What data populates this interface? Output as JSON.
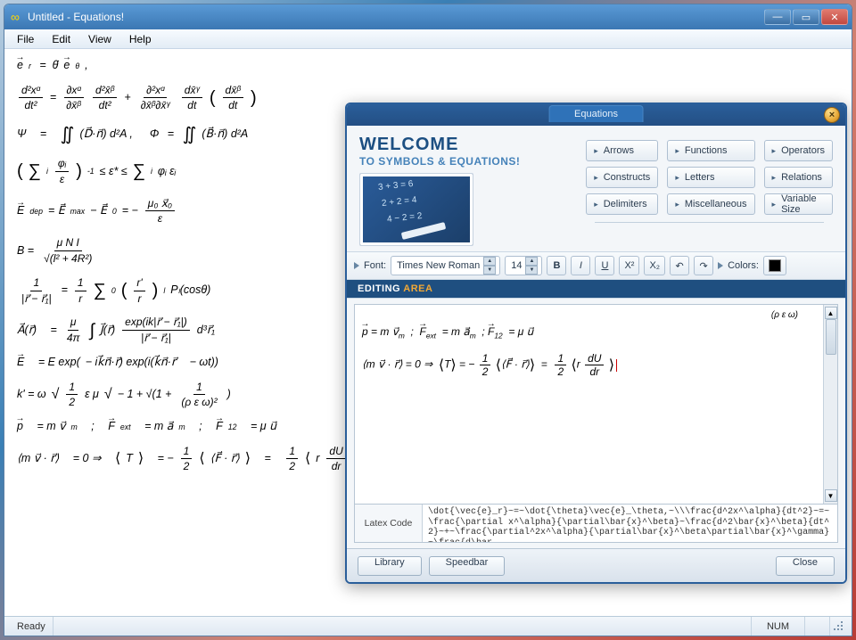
{
  "window": {
    "title": "Untitled - Equations!"
  },
  "menubar": {
    "items": [
      "File",
      "Edit",
      "View",
      "Help"
    ]
  },
  "statusbar": {
    "ready": "Ready",
    "num": "NUM"
  },
  "document": {
    "eq1": {
      "l": "e⃗",
      "lsub": "r",
      "r": "θ̇ e⃗",
      "rsub": "θ"
    },
    "eq2": {
      "f1_n": "d²xᵅ",
      "f1_d": "dt²",
      "eq": "=",
      "f2_n": "∂xᵅ",
      "f2_d": "∂x̄ᵝ",
      "f3_n": "d²x̄ᵝ",
      "f3_d": "dt²",
      "plus": "+",
      "f4_n": "∂²xᵅ",
      "f4_d": "∂x̄ᵝ∂x̄ᵞ",
      "f5_n": "dx̄ᵞ",
      "f5_d": "dt",
      "f6_n": "dx̄ᵝ",
      "f6_d": "dt"
    },
    "eq3": {
      "psi": "Ψ",
      "eq": "=",
      "int": "∬",
      "d1": "(D⃗·n⃗) d²A ,",
      "phi": "Φ",
      "b1": "(B⃗·n⃗) d²A"
    },
    "eq4": {
      "sum": "∑",
      "sub": "i",
      "f_n": "φᵢ",
      "f_d": "ε",
      "exp1": "-1",
      "le": "≤ ε* ≤",
      "sum2": "∑",
      "f2_n": "φᵢ εᵢ",
      "f2_d": ""
    },
    "eq5": {
      "E": "E⃗",
      "dep": "dep",
      "eq": "= E⃗",
      "max": "max",
      "minus": "− E⃗",
      "zero": "0",
      "eq2": "= −",
      "f_n": "μ₀ x⃗₀",
      "f_d": "ε"
    },
    "eq6": {
      "B": "B =",
      "f_n": "μ N I",
      "f_d": "√(l² + 4R²)"
    },
    "eq7": {
      "f1_n": "1",
      "f1_d": "|r⃗ − r⃗₁|",
      "eq": "=",
      "f2_n": "1",
      "f2_d": "r",
      "sum": "∑",
      "sub": "0",
      "sup": "l",
      "f3_n": "r'",
      "f3_d": "r",
      "exp": "l",
      "P": "Pₗ(cosθ)"
    },
    "eq8": {
      "A": "A⃗(r⃗)",
      "eq": "=",
      "f1_n": "μ",
      "f1_d": "4π",
      "int": "∫",
      "J": "J⃗(r⃗)",
      "f2_n": "exp(ik|r⃗ − r⃗₁|)",
      "f2_d": "|r⃗ − r⃗₁|",
      "d3r": "d³r⃗₁"
    },
    "eq9": {
      "E": "E⃗",
      "eq": "= E exp(",
      "minus": "− ik⃗n⃗·r⃗) exp(i(k⃗n⃗·r⃗",
      "om": "− ωt))"
    },
    "eq10": {
      "k": "k' = ω",
      "sqrt": "√",
      "f1_n": "1",
      "f1_d": "2",
      "eps": "ε μ",
      "sqrt2": "√",
      "expr": "− 1 + √(1 +",
      "f2_n": "1",
      "f2_d": "(ρ ε ω)²",
      "close": ")"
    },
    "eq11": {
      "p": "p⃗",
      "eq": "= m v⃗",
      "m": "m",
      "sep": ";",
      "F": "F⃗",
      "ext": "ext",
      "eq2": "= m a⃗",
      "sep2": ";",
      "F12": "F⃗",
      "sub12": "12",
      "eq3": "= μ u⃗"
    },
    "eq12": {
      "avg": "⟨m v⃗ · r⃗⟩",
      "eq": "= 0 ⇒",
      "T": "⟨T⟩",
      "eq2": "= −",
      "f1_n": "1",
      "f1_d": "2",
      "Fr": "⟨F⃗ · r⃗⟩",
      "eq3": "=",
      "f2_n": "1",
      "f2_d": "2",
      "br": "⟨r",
      "f3_n": "dU",
      "f3_d": "dr",
      "close": "⟩"
    }
  },
  "dialog": {
    "tab": "Equations",
    "welcome_h1": "WELCOME",
    "welcome_h2": "TO SYMBOLS & EQUATIONS!",
    "thumb_lines": [
      "3 + 3 = 6",
      "2 + 2 = 4",
      "4 − 2 = 2"
    ],
    "categories": [
      "Arrows",
      "Functions",
      "Operators",
      "Constructs",
      "Letters",
      "Relations",
      "Delimiters",
      "Miscellaneous",
      "Variable Size"
    ],
    "format": {
      "font_label": "Font:",
      "font_value": "Times New Roman",
      "size_value": "14",
      "bold": "B",
      "italic": "I",
      "underline": "U",
      "sup": "X²",
      "sub": "X₂",
      "undo": "↶",
      "redo": "↷",
      "colors_label": "Colors:"
    },
    "section_editing_a": "EDITING",
    "section_editing_b": "AREA",
    "editing": {
      "line0": "(ρ ε ω)",
      "line1_p": "p⃗",
      "line1_eq": "= m v⃗",
      "line1_m": "m",
      "line1_sep": ";",
      "line1_F": "F⃗",
      "line1_ext": "ext",
      "line1_eq2": "= m a⃗",
      "line1_m2": "m",
      "line1_F12": "F⃗",
      "line1_12": "12",
      "line1_eq3": "= μ u⃗",
      "line2_avg": "⟨m v⃗ · r⃗⟩",
      "line2_eq": "= 0 ⇒",
      "line2_T": "⟨T⟩",
      "line2_eq2": "= −",
      "line2_f1n": "1",
      "line2_f1d": "2",
      "line2_Fr": "⟨F⃗ · r⃗⟩",
      "line2_eq3": "=",
      "line2_f2n": "1",
      "line2_f2d": "2",
      "line2_br": "⟨r",
      "line2_f3n": "dU",
      "line2_f3d": "dr",
      "line2_cl": "⟩"
    },
    "latex_label": "Latex Code",
    "latex_value": "\\dot{\\vec{e}_r}~=~\\dot{\\theta}\\vec{e}_\\theta,~\\\\\\frac{d^2x^\\alpha}{dt^2}~=~\\frac{\\partial x^\\alpha}{\\partial\\bar{x}^\\beta}~\\frac{d^2\\bar{x}^\\beta}{dt^2}~+~\\frac{\\partial^2x^\\alpha}{\\partial\\bar{x}^\\beta\\partial\\bar{x}^\\gamma}~\\frac{d\\bar",
    "footer": {
      "library": "Library",
      "speedbar": "Speedbar",
      "close": "Close"
    }
  }
}
